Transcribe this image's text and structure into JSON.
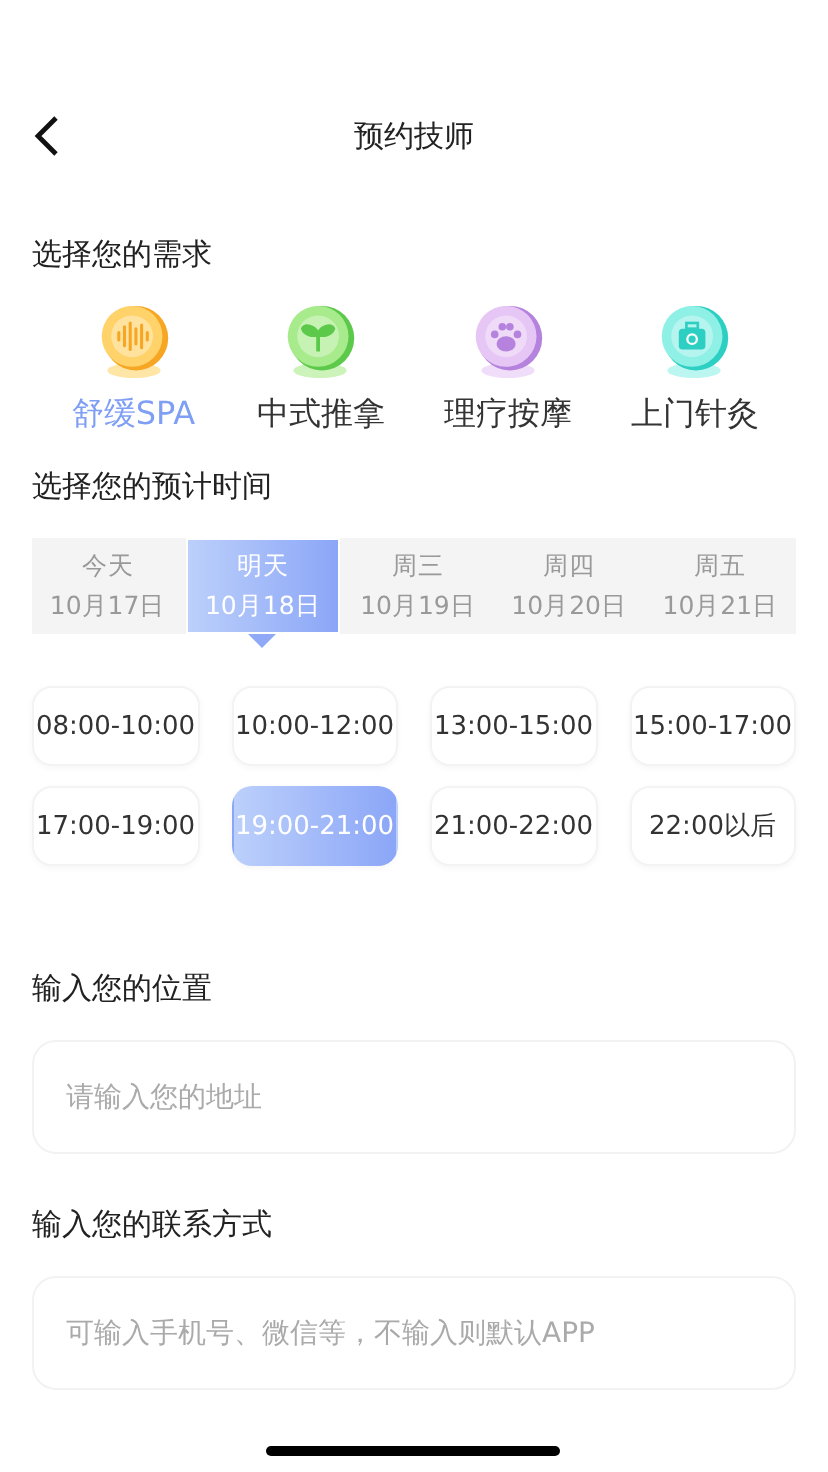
{
  "header": {
    "title": "预约技师"
  },
  "needs": {
    "title": "选择您的需求",
    "items": [
      {
        "label": "舒缓SPA",
        "kind": "wave",
        "selected": true
      },
      {
        "label": "中式推拿",
        "kind": "sprout",
        "selected": false
      },
      {
        "label": "理疗按摩",
        "kind": "paw",
        "selected": false
      },
      {
        "label": "上门针灸",
        "kind": "kit",
        "selected": false
      }
    ]
  },
  "time": {
    "title": "选择您的预计时间",
    "dates": [
      {
        "day": "今天",
        "date": "10月17日",
        "selected": false
      },
      {
        "day": "明天",
        "date": "10月18日",
        "selected": true
      },
      {
        "day": "周三",
        "date": "10月19日",
        "selected": false
      },
      {
        "day": "周四",
        "date": "10月20日",
        "selected": false
      },
      {
        "day": "周五",
        "date": "10月21日",
        "selected": false
      }
    ],
    "slots": [
      {
        "label": "08:00-10:00",
        "selected": false
      },
      {
        "label": "10:00-12:00",
        "selected": false
      },
      {
        "label": "13:00-15:00",
        "selected": false
      },
      {
        "label": "15:00-17:00",
        "selected": false
      },
      {
        "label": "17:00-19:00",
        "selected": false
      },
      {
        "label": "19:00-21:00",
        "selected": true
      },
      {
        "label": "21:00-22:00",
        "selected": false
      },
      {
        "label": "22:00以后",
        "selected": false
      }
    ]
  },
  "location": {
    "title": "输入您的位置",
    "placeholder": "请输入您的地址"
  },
  "contact": {
    "title": "输入您的联系方式",
    "placeholder": "可输入手机号、微信等，不输入则默认APP"
  }
}
